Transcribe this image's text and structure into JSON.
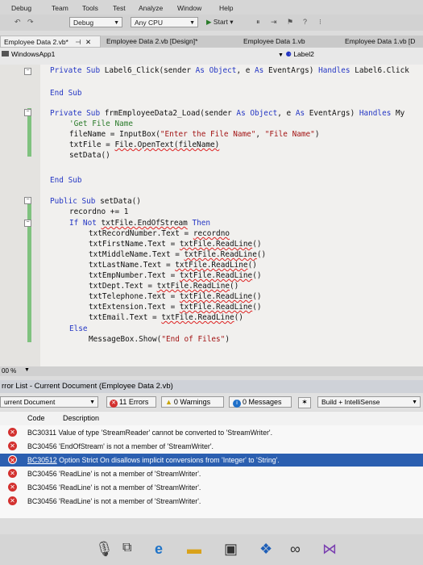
{
  "menu": [
    "Debug",
    "Team",
    "Tools",
    "Test",
    "Analyze",
    "Window",
    "Help"
  ],
  "toolbar": {
    "config": "Debug",
    "platform": "Any CPU",
    "start_label": "Start"
  },
  "tabs": [
    {
      "label": "Employee Data 2.vb*"
    },
    {
      "label": "Employee Data 2.vb [Design]*"
    },
    {
      "label": "Employee Data 1.vb"
    },
    {
      "label": "Employee Data 1.vb [D"
    }
  ],
  "navbar": {
    "project": "WindowsApp1",
    "member": "Label2"
  },
  "code": [
    "Private Sub Label6_Click(sender As Object, e As EventArgs) Handles Label6.Click",
    "End Sub",
    "Private Sub frmEmployeeData2_Load(sender As Object, e As EventArgs) Handles My",
    "'Get File Name",
    "fileName = InputBox(\"Enter the File Name\", \"File Name\")",
    "txtFile = File.OpenText(fileName)",
    "setData()",
    "End Sub",
    "Public Sub setData()",
    "recordno += 1",
    "If Not txtFile.EndOfStream Then",
    "txtRecordNumber.Text = recordno",
    "txtFirstName.Text = txtFile.ReadLine()",
    "txtMiddleName.Text = txtFile.ReadLine()",
    "txtLastName.Text = txtFile.ReadLine()",
    "txtEmpNumber.Text = txtFile.ReadLine()",
    "txtDept.Text = txtFile.ReadLine()",
    "txtTelephone.Text = txtFile.ReadLine()",
    "txtExtension.Text = txtFile.ReadLine()",
    "txtEmail.Text = txtFile.ReadLine()",
    "Else",
    "MessageBox.Show(\"End of Files\")"
  ],
  "zoom": "00 %",
  "error_list": {
    "title": "rror List - Current Document (Employee Data 2.vb)",
    "scope": "urrent Document",
    "errors_btn": "11 Errors",
    "warnings_btn": "0 Warnings",
    "messages_btn": "0 Messages",
    "build_filter": "Build + IntelliSense",
    "col_code": "Code",
    "col_desc": "Description",
    "rows": [
      {
        "code": "BC30311",
        "desc": "Value of type 'StreamReader' cannot be converted to 'StreamWriter'."
      },
      {
        "code": "BC30456",
        "desc": "'EndOfStream' is not a member of 'StreamWriter'."
      },
      {
        "code": "BC30512",
        "desc": "Option Strict On disallows implicit conversions from 'Integer' to 'String'."
      },
      {
        "code": "BC30456",
        "desc": "'ReadLine' is not a member of 'StreamWriter'."
      },
      {
        "code": "BC30456",
        "desc": "'ReadLine' is not a member of 'StreamWriter'."
      },
      {
        "code": "BC30456",
        "desc": "'ReadLine' is not a member of 'StreamWriter'."
      }
    ]
  },
  "colors": {
    "selected_row": "#2b5fb0",
    "error_red": "#d3312f",
    "keyword_blue": "#2436c4",
    "string_red": "#a31515",
    "comment_green": "#2a7b2a"
  }
}
